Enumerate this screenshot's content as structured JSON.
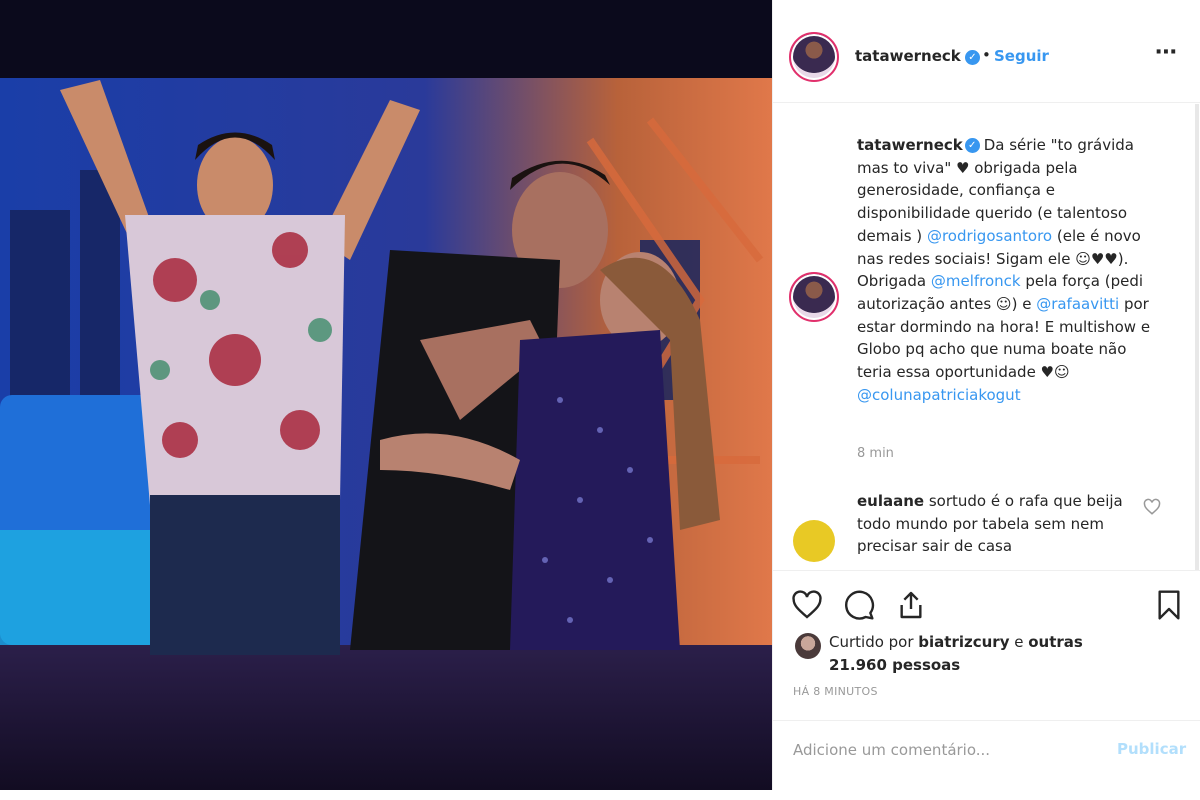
{
  "post": {
    "username": "tatawerneck",
    "follow_label": "Seguir",
    "separator": "•",
    "more_icon": "⋯",
    "verified_glyph": "✓"
  },
  "caption": {
    "username": "tatawerneck",
    "part1": "Da série \"to grávida mas to viva\" ♥ obrigada pela generosidade, confiança e disponibilidade querido (e talentoso demais ) ",
    "mention1": "@rodrigosantoro",
    "part2": " (ele é novo nas redes sociais! Sigam ele ☺♥♥). Obrigada ",
    "mention2": "@melfronck",
    "part3": " pela força (pedi autorização antes ☺) e ",
    "mention3": "@rafaavitti",
    "part4": " por estar dormindo na hora! E multishow e Globo pq acho que numa boate não teria essa oportunidade ♥☺ ",
    "mention4": "@colunapatriciakogut",
    "time": "8 min"
  },
  "comment": {
    "username": "eulaane",
    "text": " sortudo é o rafa que beija todo mundo por tabela sem nem precisar sair de casa"
  },
  "likes": {
    "prefix": "Curtido por ",
    "user": "biatrizcury",
    "middle": " e ",
    "others": "outras 21.960 pessoas"
  },
  "timestamp": "HÁ 8 MINUTOS",
  "add_comment": {
    "placeholder": "Adicione um comentário...",
    "publish_label": "Publicar"
  },
  "colors": {
    "accent": "#3897f0",
    "publish_disabled": "#b2dffc",
    "text": "#262626",
    "muted": "#999999"
  }
}
